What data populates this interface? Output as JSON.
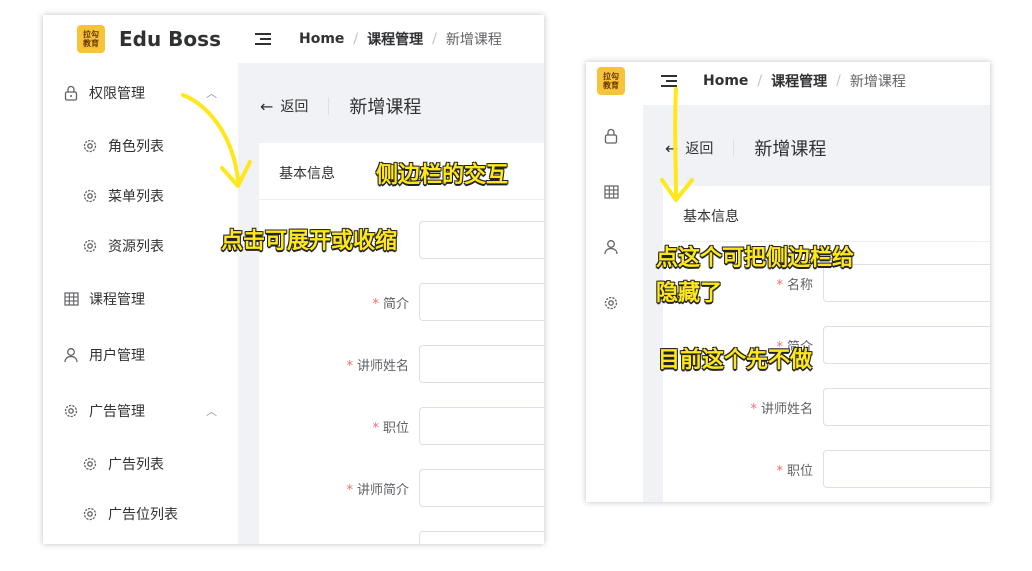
{
  "left": {
    "logo": {
      "line1": "拉勾",
      "line2": "教育"
    },
    "brand": "Edu Boss",
    "breadcrumb": {
      "home": "Home",
      "mid": "课程管理",
      "current": "新增课程",
      "sep": "/"
    },
    "sidebar": {
      "items": [
        {
          "label": "权限管理",
          "icon": "lock-icon"
        },
        {
          "label": "角色列表",
          "icon": "gear-icon"
        },
        {
          "label": "菜单列表",
          "icon": "gear-icon"
        },
        {
          "label": "资源列表",
          "icon": "gear-icon"
        },
        {
          "label": "课程管理",
          "icon": "grid-icon"
        },
        {
          "label": "用户管理",
          "icon": "user-icon"
        },
        {
          "label": "广告管理",
          "icon": "gear-icon"
        },
        {
          "label": "广告列表",
          "icon": "gear-icon"
        },
        {
          "label": "广告位列表",
          "icon": "gear-icon"
        }
      ]
    },
    "back_label": "返回",
    "page_title": "新增课程",
    "card_header": "基本信息",
    "form": {
      "fields": [
        {
          "label": "简介"
        },
        {
          "label": "讲师姓名"
        },
        {
          "label": "职位"
        },
        {
          "label": "讲师简介"
        }
      ],
      "required_mark": "*"
    },
    "annotations": {
      "top": "侧边栏的交互",
      "bottom": "点击可展开或收缩"
    }
  },
  "right": {
    "logo": {
      "line1": "拉勾",
      "line2": "教育"
    },
    "breadcrumb": {
      "home": "Home",
      "mid": "课程管理",
      "current": "新增课程",
      "sep": "/"
    },
    "back_label": "返回",
    "page_title": "新增课程",
    "card_header": "基本信息",
    "form": {
      "fields": [
        {
          "label": "名称"
        },
        {
          "label": "简介"
        },
        {
          "label": "讲师姓名"
        },
        {
          "label": "职位"
        }
      ],
      "required_mark": "*"
    },
    "annotations": {
      "line1": "点这个可把侧边栏给",
      "line2": "隐藏了",
      "line3": "目前这个先不做"
    }
  },
  "colors": {
    "accent_annotation": "#ffe71a",
    "required": "#f56c6c",
    "logo_bg": "#f7c33b",
    "content_bg": "#f0f2f5"
  }
}
